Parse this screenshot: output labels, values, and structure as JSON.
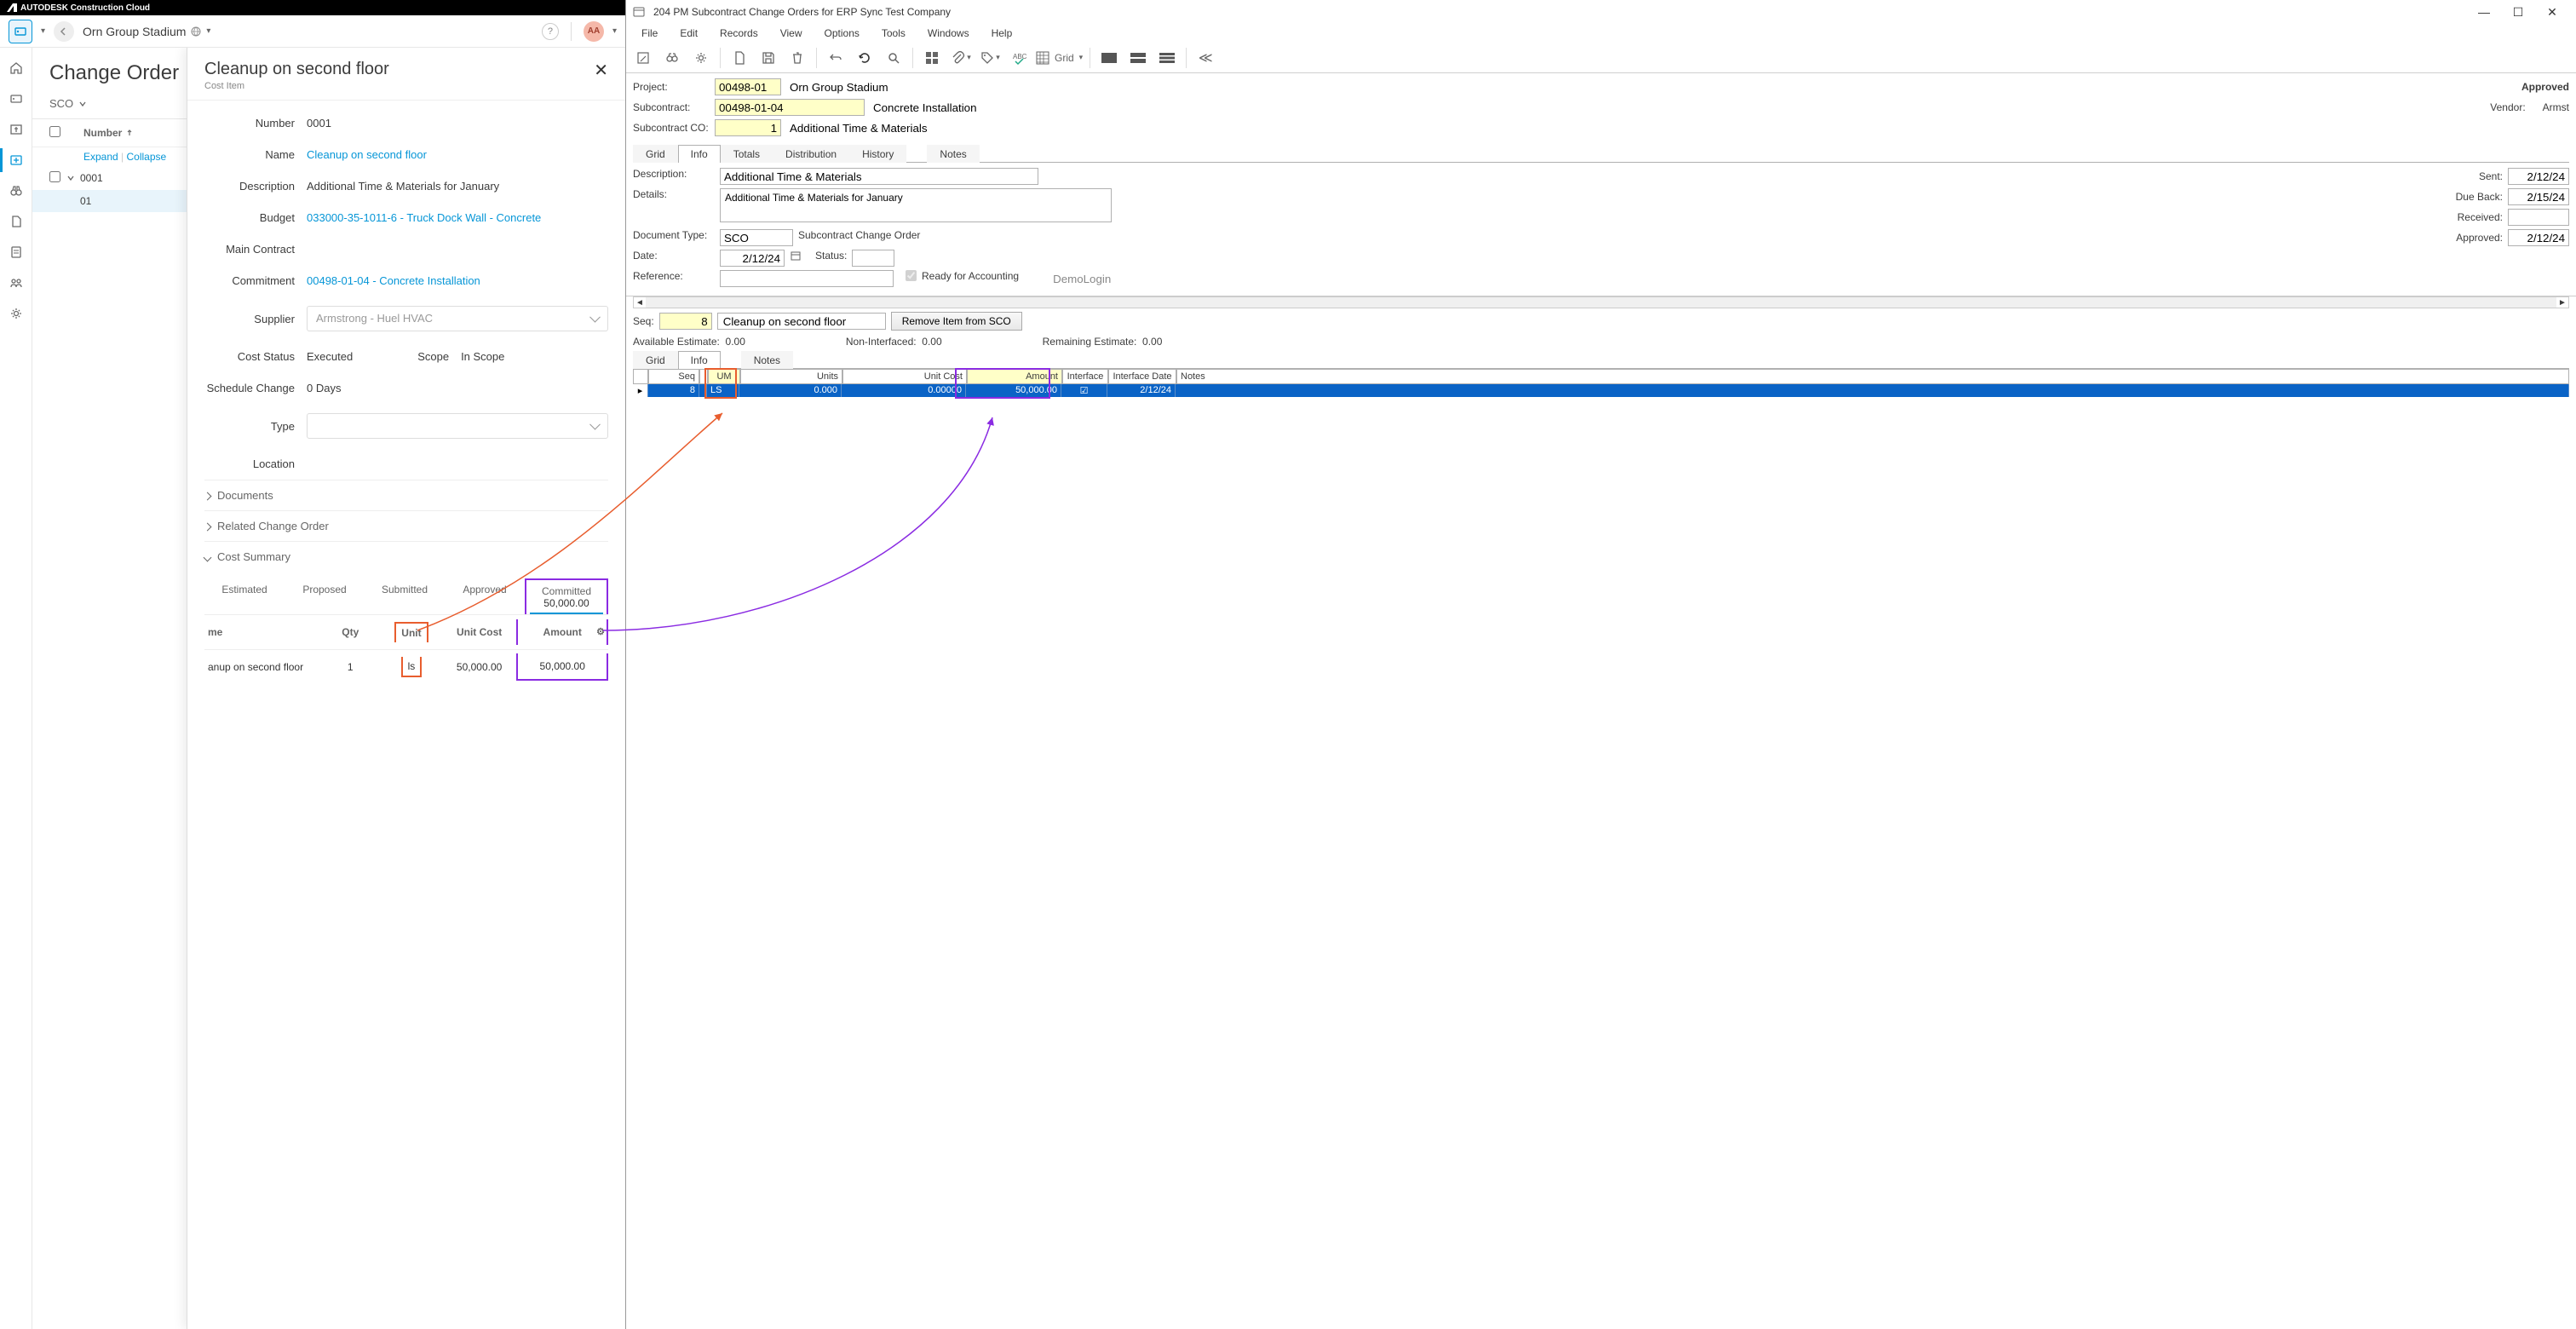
{
  "acc": {
    "brand": "AUTODESK Construction Cloud",
    "project_name": "Orn Group Stadium",
    "avatar": "AA",
    "page_title": "Change Order",
    "co_filter": "SCO",
    "list": {
      "header_number": "Number",
      "expand": "Expand",
      "collapse": "Collapse",
      "rows": [
        {
          "num": "0001",
          "sub": false
        },
        {
          "num": "01",
          "sub": true,
          "selected": true
        }
      ]
    },
    "detail": {
      "title": "Cleanup on second floor",
      "subtitle": "Cost Item",
      "number_lbl": "Number",
      "number_val": "0001",
      "name_lbl": "Name",
      "name_val": "Cleanup on second floor",
      "desc_lbl": "Description",
      "desc_val": "Additional Time & Materials for January",
      "budget_lbl": "Budget",
      "budget_val": "033000-35-1011-6 - Truck Dock Wall - Concrete",
      "contract_lbl": "Main Contract",
      "commitment_lbl": "Commitment",
      "commitment_val": "00498-01-04 - Concrete Installation",
      "supplier_lbl": "Supplier",
      "supplier_val": "Armstrong - Huel HVAC",
      "cost_status_lbl": "Cost Status",
      "cost_status_val": "Executed",
      "scope_lbl": "Scope",
      "scope_val": "In Scope",
      "schedule_lbl": "Schedule Change",
      "schedule_val": "0  Days",
      "type_lbl": "Type",
      "location_lbl": "Location",
      "sec_documents": "Documents",
      "sec_related": "Related Change Order",
      "sec_cost": "Cost Summary",
      "cs": {
        "h_est": "Estimated",
        "h_prop": "Proposed",
        "h_sub": "Submitted",
        "h_app": "Approved",
        "h_com": "Committed",
        "com_val": "50,000.00",
        "me": "me",
        "qty": "Qty",
        "unit": "Unit",
        "uc": "Unit Cost",
        "amt": "Amount",
        "d_me": "anup on second floor",
        "d_qty": "1",
        "d_unit": "ls",
        "d_uc": "50,000.00",
        "d_amt": "50,000.00"
      }
    }
  },
  "erp": {
    "win_title": "204 PM Subcontract Change Orders for ERP Sync Test Company",
    "menus": [
      "File",
      "Edit",
      "Records",
      "View",
      "Options",
      "Tools",
      "Windows",
      "Help"
    ],
    "grid_label": "Grid",
    "project_lbl": "Project:",
    "project_val": "00498-01",
    "project_name": "Orn Group Stadium",
    "subcontract_lbl": "Subcontract:",
    "subcontract_val": "00498-01-04",
    "subcontract_name": "Concrete Installation",
    "subco_lbl": "Subcontract CO:",
    "subco_val": "1",
    "subco_name": "Additional Time & Materials",
    "approved": "Approved",
    "vendor_lbl": "Vendor:",
    "vendor_val": "Armst",
    "tabs": [
      "Grid",
      "Info",
      "Totals",
      "Distribution",
      "History",
      "Notes"
    ],
    "info": {
      "desc_lbl": "Description:",
      "desc_val": "Additional Time & Materials",
      "details_lbl": "Details:",
      "details_val": "Additional Time & Materials for January",
      "doctype_lbl": "Document Type:",
      "doctype_val": "SCO",
      "doctype_name": "Subcontract Change Order",
      "date_lbl": "Date:",
      "date_val": "2/12/24",
      "status_lbl": "Status:",
      "ref_lbl": "Reference:",
      "ready_lbl": "Ready for Accounting",
      "demo": "DemoLogin",
      "sent_lbl": "Sent:",
      "sent_val": "2/12/24",
      "due_lbl": "Due Back:",
      "due_val": "2/15/24",
      "recv_lbl": "Received:",
      "appr_lbl": "Approved:",
      "appr_val": "2/12/24"
    },
    "seq_lbl": "Seq:",
    "seq_val": "8",
    "seq_desc": "Cleanup on second floor",
    "remove_btn": "Remove Item from SCO",
    "avail_lbl": "Available Estimate:",
    "avail_val": "0.00",
    "nonint_lbl": "Non-Interfaced:",
    "nonint_val": "0.00",
    "remain_lbl": "Remaining Estimate:",
    "remain_val": "0.00",
    "sub_tabs": [
      "Grid",
      "Info",
      "Notes"
    ],
    "grid": {
      "h_seq": "Seq",
      "h_um": "UM",
      "h_units": "Units",
      "h_uc": "Unit Cost",
      "h_amt": "Amount",
      "h_int": "Interface",
      "h_idate": "Interface Date",
      "h_notes": "Notes",
      "d_seq": "8",
      "d_um": "LS",
      "d_units": "0.000",
      "d_uc": "0.00000",
      "d_amt": "50,000.00",
      "d_idate": "2/12/24"
    }
  }
}
